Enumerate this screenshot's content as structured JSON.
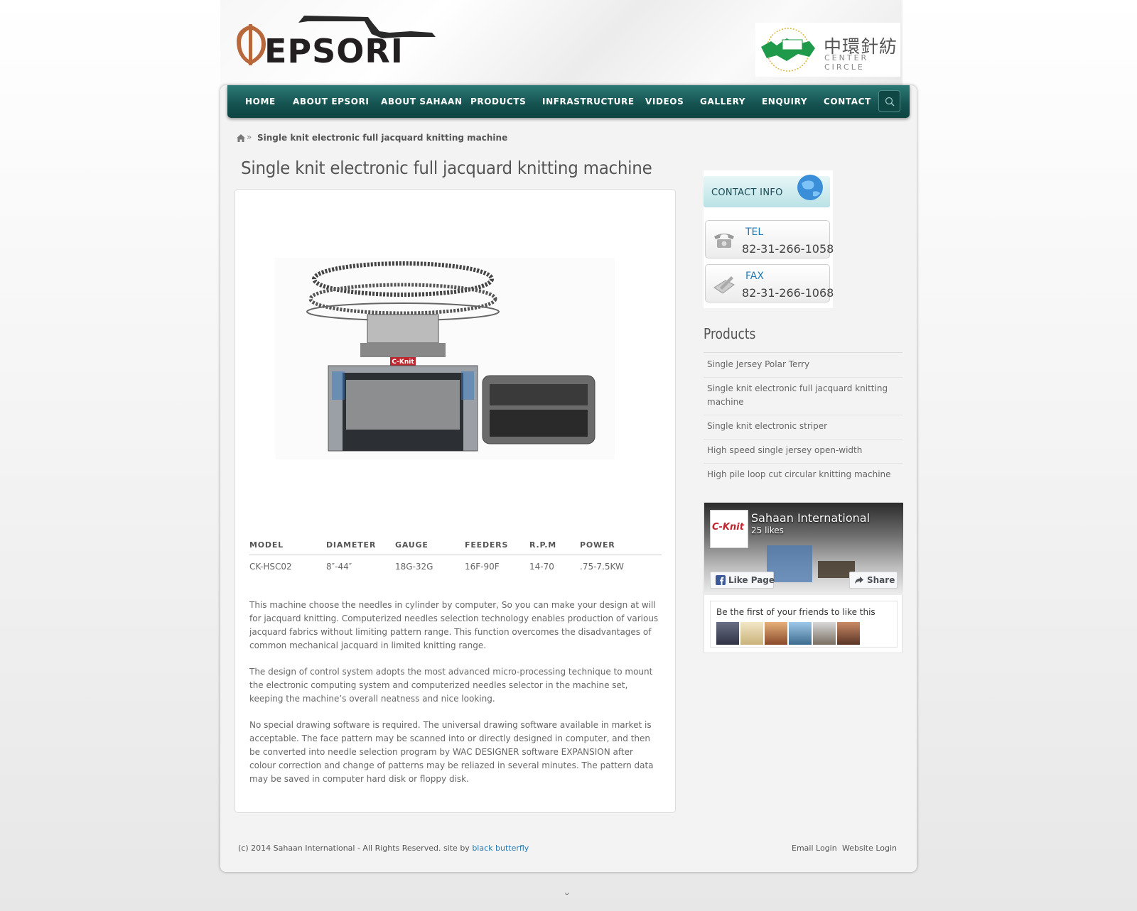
{
  "header": {
    "logo_text": "EPSORI",
    "partner_logo": {
      "chinese": "中環針紡",
      "english": "CENTER CIRCLE",
      "badge": "CENTER CIRCLE"
    }
  },
  "nav": {
    "items": [
      {
        "label": "HOME"
      },
      {
        "label": "ABOUT EPSORI"
      },
      {
        "label": "ABOUT SAHAAN"
      },
      {
        "label": "PRODUCTS"
      },
      {
        "label": "INFRASTRUCTURE"
      },
      {
        "label": "VIDEOS"
      },
      {
        "label": "GALLERY"
      },
      {
        "label": "ENQUIRY"
      },
      {
        "label": "CONTACT"
      }
    ],
    "search_icon": "search-icon"
  },
  "breadcrumb": {
    "home_icon": "home-icon",
    "separator": "»",
    "current": "Single knit electronic full jacquard knitting machine"
  },
  "page": {
    "title": "Single knit electronic full jacquard knitting machine",
    "product_image_badge": "C-Knit",
    "specs": {
      "headers": [
        "MODEL",
        "DIAMETER",
        "GAUGE",
        "FEEDERS",
        "R.P.M",
        "POWER"
      ],
      "row": [
        "CK-HSC02",
        "8″-44″",
        "18G-32G",
        "16F-90F",
        "14-70",
        ".75-7.5KW"
      ]
    },
    "paragraphs": [
      "This machine choose the needles in cylinder by computer, So you can make your design at will for jacquard knitting. Computerized needles selection technology enables production of various jacquard fabrics without limiting pattern range. This function overcomes the disadvantages of common mechanical jacquard in limited knitting range.",
      "The design of control system adopts the most advanced micro-processing technique to mount the electronic computing system and computerized needles selector in the machine set, keeping the machine’s overall neatness and nice looking.",
      "No special drawing software is required. The universal drawing software available in market is acceptable. The face pattern may be scanned into or directly designed in computer, and then be converted into needle selection program by WAC DESIGNER software EXPANSION after colour correction and change of patterns may be reliazed in several minutes. The pattern data may be saved in computer hard disk or floppy disk."
    ]
  },
  "sidebar": {
    "contact": {
      "header": "CONTACT INFO",
      "tel_label": "TEL",
      "tel_value": "82-31-266-1058",
      "fax_label": "FAX",
      "fax_value": "82-31-266-1068"
    },
    "products_heading": "Products",
    "products": [
      {
        "label": "Single Jersey Polar Terry"
      },
      {
        "label": "Single knit electronic full jacquard knitting machine"
      },
      {
        "label": "Single knit electronic striper"
      },
      {
        "label": "High speed single jersey open-width"
      },
      {
        "label": "High pile loop cut circular knitting machine"
      }
    ],
    "facebook": {
      "page_name": "Sahaan International",
      "likes": "25 likes",
      "logo_text": "C-Knit",
      "like_button": "Like Page",
      "share_button": "Share",
      "friends_text": "Be the first of your friends to like this"
    }
  },
  "footer": {
    "copyright": "(c) 2014 Sahaan International - All Rights Reserved. site by ",
    "credit_link": "black butterfly",
    "email_login": "Email Login",
    "website_login": "Website Login"
  },
  "bottom_glyph": "ᴗ",
  "colors": {
    "nav_bg": "#14514f",
    "link": "#2a7ab0",
    "tel_label": "#1f7ab8"
  }
}
